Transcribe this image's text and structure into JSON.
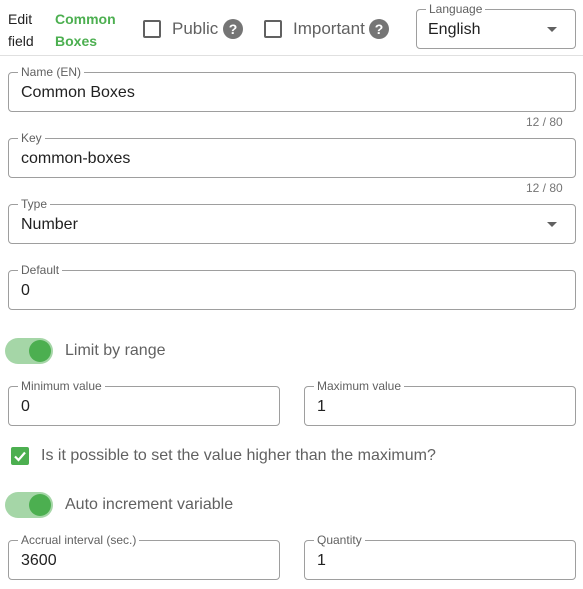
{
  "header": {
    "edit_field_label": "Edit field",
    "field_name": "Common Boxes",
    "public_label": "Public",
    "important_label": "Important",
    "help_glyph": "?",
    "language": {
      "label": "Language",
      "value": "English"
    }
  },
  "form": {
    "name": {
      "label": "Name (EN)",
      "value": "Common Boxes",
      "counter": "12 / 80"
    },
    "key": {
      "label": "Key",
      "value": "common-boxes",
      "counter": "12 / 80"
    },
    "type": {
      "label": "Type",
      "value": "Number"
    },
    "default": {
      "label": "Default",
      "value": "0"
    },
    "limit_by_range": {
      "label": "Limit by range",
      "on": true
    },
    "minimum": {
      "label": "Minimum value",
      "value": "0"
    },
    "maximum": {
      "label": "Maximum value",
      "value": "1"
    },
    "allow_exceed": {
      "label": "Is it possible to set the value higher than the maximum?",
      "checked": true
    },
    "auto_increment": {
      "label": "Auto increment variable",
      "on": true
    },
    "accrual_interval": {
      "label": "Accrual interval (sec.)",
      "value": "3600"
    },
    "quantity": {
      "label": "Quantity",
      "value": "1"
    }
  },
  "colors": {
    "accent": "#4caf50",
    "accent_light": "#a5d6a7",
    "border": "#9e9e9e"
  }
}
